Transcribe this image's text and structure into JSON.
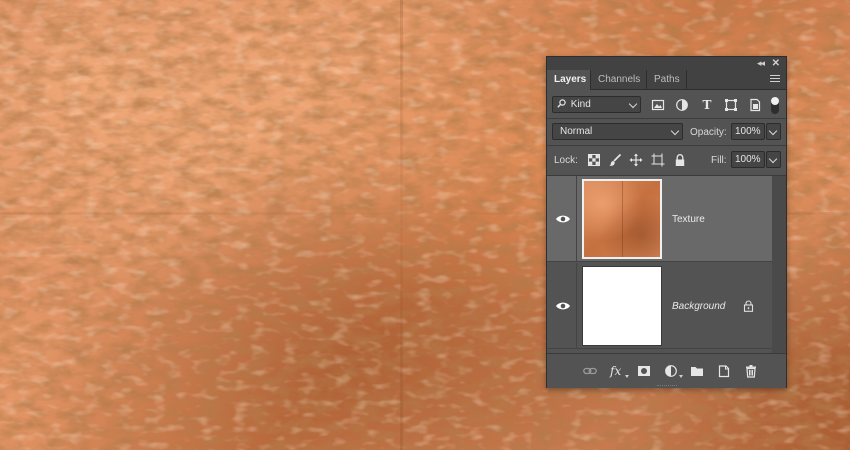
{
  "panel": {
    "collapse_glyph": "◂◂",
    "close_glyph": "✕",
    "tabs": [
      {
        "label": "Layers",
        "active": true
      },
      {
        "label": "Channels",
        "active": false
      },
      {
        "label": "Paths",
        "active": false
      }
    ],
    "filter": {
      "kind_label": "Kind",
      "icons": [
        "image-icon",
        "adjustment-circle-icon",
        "type-icon",
        "shape-icon",
        "smart-object-icon"
      ],
      "type_glyph": "T"
    },
    "blend": {
      "mode": "Normal",
      "opacity_label": "Opacity:",
      "opacity_value": "100%"
    },
    "lock": {
      "label": "Lock:",
      "icons": [
        "lock-transparent-icon",
        "lock-image-brush-icon",
        "lock-position-move-icon",
        "lock-artboard-icon",
        "lock-all-icon"
      ],
      "fill_label": "Fill:",
      "fill_value": "100%"
    },
    "layers": [
      {
        "name": "Texture",
        "visible": true,
        "selected": true,
        "locked": false
      },
      {
        "name": "Background",
        "visible": true,
        "selected": false,
        "locked": true
      }
    ],
    "bottom_bar": {
      "fx_glyph": "fx",
      "icons": [
        "link-icon",
        "fx-icon",
        "mask-icon",
        "adjustment-layer-icon",
        "group-folder-icon",
        "new-layer-icon",
        "trash-icon"
      ]
    }
  },
  "colors": {
    "panel_bg": "#535353",
    "selected_row": "#696969",
    "copper_light": "#e59869",
    "copper_dark": "#c06c3d"
  }
}
